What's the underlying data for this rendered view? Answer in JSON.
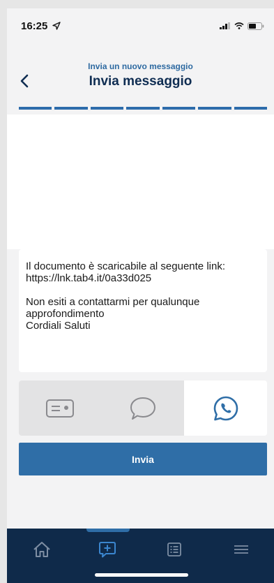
{
  "status_bar": {
    "time": "16:25",
    "icons": [
      "location-arrow-icon",
      "signal-icon",
      "wifi-icon",
      "battery-icon"
    ]
  },
  "header": {
    "subtitle": "Invia un nuovo messaggio",
    "title": "Invia messaggio",
    "back_icon": "chevron-left-icon",
    "steps_total": 7,
    "steps_completed": 7
  },
  "message": {
    "paragraphs": [
      "Il documento è scaricabile al seguente link: https://lnk.tab4.it/0a33d025",
      "Non esiti a contattarmi per qualunque approfondimento\nCordiali Saluti"
    ]
  },
  "channels": {
    "items": [
      {
        "icon": "sms-card-icon",
        "selected": false
      },
      {
        "icon": "chat-bubble-icon",
        "selected": false
      },
      {
        "icon": "whatsapp-icon",
        "selected": true
      }
    ]
  },
  "actions": {
    "send_label": "Invia"
  },
  "bottom_nav": {
    "items": [
      {
        "icon": "home-icon",
        "active": false
      },
      {
        "icon": "message-plus-icon",
        "active": true
      },
      {
        "icon": "list-icon",
        "active": false
      },
      {
        "icon": "menu-icon",
        "active": false
      }
    ]
  },
  "colors": {
    "accent": "#2f6ea7",
    "title": "#0f2d52",
    "nav_background": "#0f2a4a",
    "whatsapp": "#2f6ea7"
  }
}
